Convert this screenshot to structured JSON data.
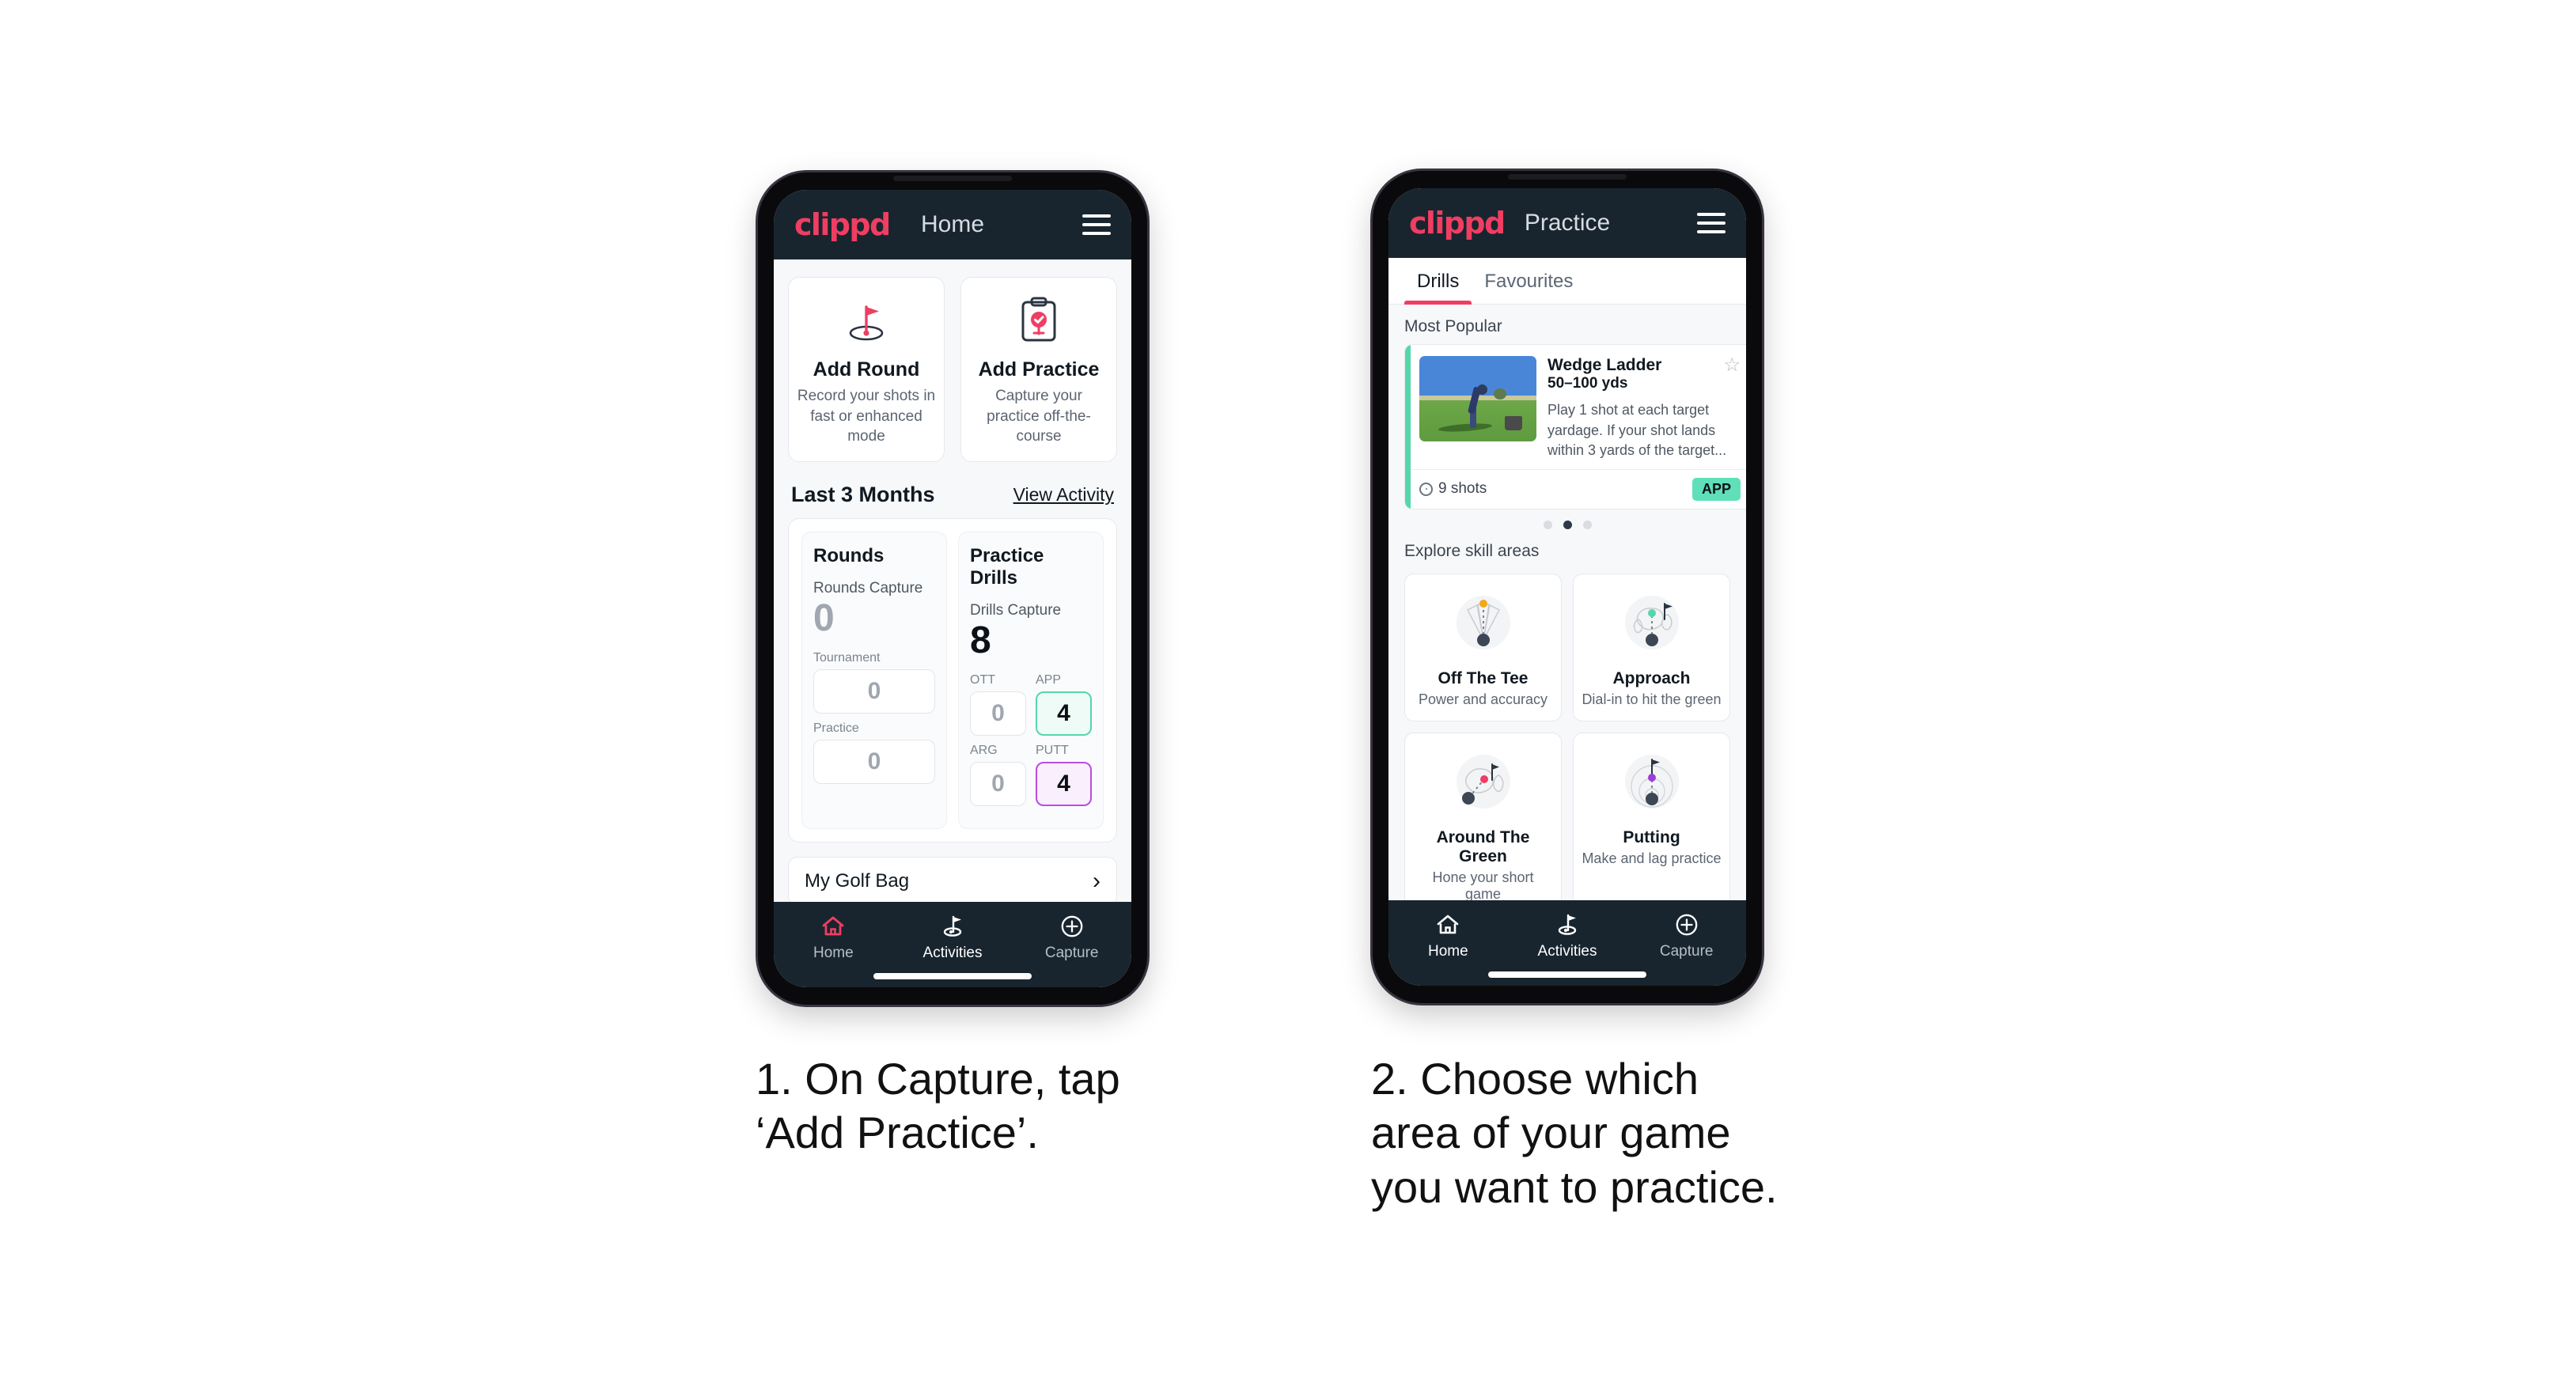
{
  "phone1": {
    "header": {
      "logo": "clippd",
      "title": "Home",
      "menu_icon": "hamburger-icon"
    },
    "actions": [
      {
        "icon": "golf-flag-hole-icon",
        "title": "Add Round",
        "subtitle": "Record your shots in fast or enhanced mode"
      },
      {
        "icon": "clipboard-check-icon",
        "title": "Add Practice",
        "subtitle": "Capture your practice off-the-course"
      }
    ],
    "section": {
      "title": "Last 3 Months",
      "link": "View Activity"
    },
    "rounds": {
      "heading": "Rounds",
      "capture_label": "Rounds Capture",
      "capture_value": "0",
      "items": [
        {
          "label": "Tournament",
          "value": "0",
          "highlight": "none"
        },
        {
          "label": "Practice",
          "value": "0",
          "highlight": "none"
        }
      ]
    },
    "drills": {
      "heading": "Practice Drills",
      "capture_label": "Drills Capture",
      "capture_value": "8",
      "items": [
        {
          "label": "OTT",
          "value": "0",
          "highlight": "none"
        },
        {
          "label": "APP",
          "value": "4",
          "highlight": "green"
        },
        {
          "label": "ARG",
          "value": "0",
          "highlight": "none"
        },
        {
          "label": "PUTT",
          "value": "4",
          "highlight": "purple"
        }
      ]
    },
    "golf_bag": {
      "label": "My Golf Bag",
      "chevron": "chevron-right-icon"
    },
    "nav": [
      {
        "icon": "home-icon",
        "label": "Home",
        "state": "active-pink"
      },
      {
        "icon": "golf-flag-icon",
        "label": "Activities",
        "state": "active-white"
      },
      {
        "icon": "plus-circle-icon",
        "label": "Capture",
        "state": "inactive"
      }
    ]
  },
  "phone2": {
    "header": {
      "logo": "clippd",
      "title": "Practice",
      "menu_icon": "hamburger-icon"
    },
    "tabs": [
      {
        "label": "Drills",
        "active": true
      },
      {
        "label": "Favourites",
        "active": false
      }
    ],
    "most_popular_label": "Most Popular",
    "drill": {
      "name": "Wedge Ladder",
      "yardage": "50–100 yds",
      "description": "Play 1 shot at each target yardage. If your shot lands within 3 yards of the target...",
      "shots": "9 shots",
      "badge": "APP",
      "star_icon": "star-outline-icon",
      "accent_color": "#56d6ab",
      "next_accent_color": "#b24de0"
    },
    "carousel_dots": {
      "count": 3,
      "active_index": 1
    },
    "explore_label": "Explore skill areas",
    "skills": [
      {
        "icon": "off-the-tee-icon",
        "title": "Off The Tee",
        "subtitle": "Power and accuracy",
        "dot_color": "#f2a818"
      },
      {
        "icon": "approach-icon",
        "title": "Approach",
        "subtitle": "Dial-in to hit the green",
        "dot_color": "#56d6ab"
      },
      {
        "icon": "around-the-green-icon",
        "title": "Around The Green",
        "subtitle": "Hone your short game",
        "dot_color": "#ef3e62"
      },
      {
        "icon": "putting-icon",
        "title": "Putting",
        "subtitle": "Make and lag practice",
        "dot_color": "#9b3fd4"
      }
    ],
    "nav": [
      {
        "icon": "home-icon",
        "label": "Home",
        "state": "inactive-white"
      },
      {
        "icon": "golf-flag-icon",
        "label": "Activities",
        "state": "active-white"
      },
      {
        "icon": "plus-circle-icon",
        "label": "Capture",
        "state": "inactive"
      }
    ]
  },
  "captions": [
    "1. On Capture, tap\n‘Add Practice’.",
    "2. Choose which\narea of your game\nyou want to practice."
  ],
  "colors": {
    "brand_pink": "#ef3e62",
    "header_navy": "#18252f",
    "accent_green": "#56d6ab",
    "accent_purple": "#b24de0",
    "page_bg": "#f7f8fa"
  }
}
